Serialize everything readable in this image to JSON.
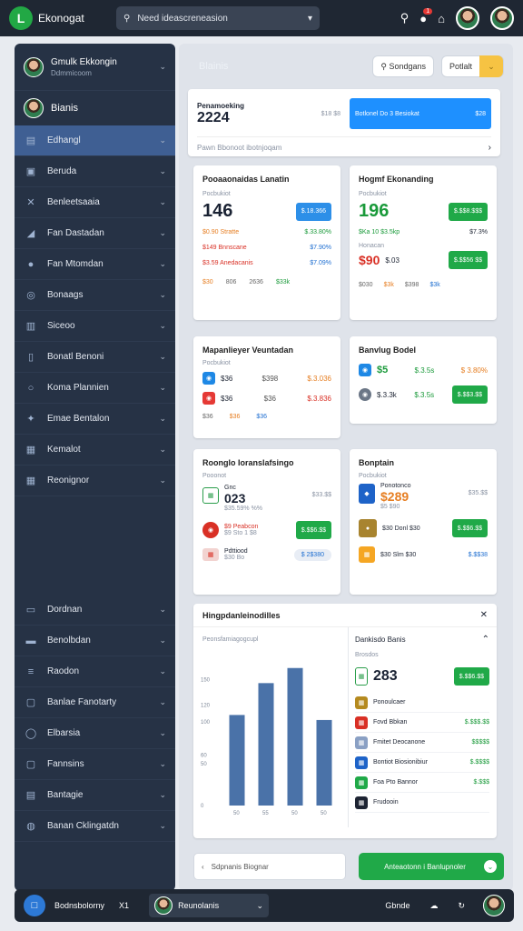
{
  "header": {
    "brand": "Ekonogat",
    "search_placeholder": "Need ideascreneasion",
    "badge_count": "1"
  },
  "sidebar": {
    "user": {
      "name": "Gmulk Ekkongin",
      "sub": "Ddmmicoom"
    },
    "second_user": "Bianis",
    "items": [
      {
        "label": "Edhangl",
        "icon": "▤"
      },
      {
        "label": "Beruda",
        "icon": "▣"
      },
      {
        "label": "Benleetsaaia",
        "icon": "✕"
      },
      {
        "label": "Fan Dastadan",
        "icon": "◢"
      },
      {
        "label": "Fan Mtomdan",
        "icon": "●"
      },
      {
        "label": "Bonaags",
        "icon": "◎"
      },
      {
        "label": "Siceoo",
        "icon": "▥"
      },
      {
        "label": "Bonatl Benoni",
        "icon": "▯"
      },
      {
        "label": "Koma Plannien",
        "icon": "○"
      },
      {
        "label": "Emae Bentalon",
        "icon": "✦"
      },
      {
        "label": "Kemalot",
        "icon": "▦"
      },
      {
        "label": "Reonignor",
        "icon": "▦"
      }
    ],
    "lower_items": [
      {
        "label": "Dordnan",
        "icon": "▭"
      },
      {
        "label": "Benolbdan",
        "icon": "▬"
      },
      {
        "label": "Raodon",
        "icon": "≡"
      },
      {
        "label": "Banlae Fanotarty",
        "icon": "▢"
      },
      {
        "label": "Elbarsia",
        "icon": "◯"
      },
      {
        "label": "Fannsins",
        "icon": "▢"
      },
      {
        "label": "Bantagie",
        "icon": "▤"
      },
      {
        "label": "Banan Cklingatdn",
        "icon": "◍"
      }
    ]
  },
  "main": {
    "title": "Blainis",
    "btn_search": "Sondgans",
    "btn_filter": "Potlalt",
    "summary": {
      "title": "Penamoeking",
      "year": "2224",
      "amount_right": "$18 $8",
      "banner": "Botlonel Do 3 Besiokat",
      "banner_amount": "$28",
      "sub": "Pawn Bbonoot ibotnjoqam"
    },
    "card_a": {
      "title": "Pooaaonaidas Lanatin",
      "sub": "Pocbukiot",
      "value": "146",
      "btn": "$.18.366",
      "line1_l": "$0.90 Stratte",
      "line1_r": "$.33.80%",
      "line2_l": "$149 Bnnscane",
      "line2_r": "$7.90%",
      "line3_l": "$3.59 Anedacanis",
      "line3_r": "$7.09%",
      "foot": [
        "$30",
        "806",
        "2636",
        "$33k"
      ]
    },
    "card_b": {
      "title": "Hogmf Ekonanding",
      "sub": "Pocbukiot",
      "value": "196",
      "btn": "$.$$8.$$$",
      "line1_l": "$Ka 10 $3.5kp",
      "line1_r": "$7.3%",
      "line2_l": "Honacan",
      "val2": "$90",
      "val2b": "$.03",
      "btn2": "$.$$56 $$",
      "foot": [
        "$030",
        "$3k",
        "$398",
        "$3k"
      ]
    },
    "card_c": {
      "title": "Mapanlieyer Veuntadan",
      "sub": "Pocbukiot",
      "a": "$36",
      "a2": "$398",
      "a3": "$.3.036",
      "b": "$36",
      "b2": "$36",
      "b3": "$.3.836",
      "foot": [
        "$36",
        "$36",
        "$36"
      ]
    },
    "card_d": {
      "title": "Banvlug Bodel",
      "a": "$5",
      "a2": "$.3.5s",
      "a3": "$ 3.80%",
      "b": "$.3.3k",
      "b2": "$.3.5s",
      "btn": "$.$$3.$$"
    },
    "card_e": {
      "title": "Roonglo Ioranslafsingo",
      "sub": "Pooonot",
      "value": "023",
      "value_pre": "Gnc",
      "note": "$35.59% %%",
      "r1": "$33.$$",
      "row2": "$9 Peabcon",
      "row2b": "$9 Sto 1 $8",
      "btn": "$.$$6.$$",
      "row3": "Pdttiood",
      "row3b": "$30 Bo",
      "pill": "$ 2$380"
    },
    "card_f": {
      "title": "Bonptain",
      "sub": "Pocbukiot",
      "value": "$289",
      "value_pre": "Ponotonco",
      "note": "$5 $90",
      "r1": "$35.$$",
      "row2": "$30 Donl $30",
      "btn": "$.$$6.$$",
      "row3": "$30 Slm $30",
      "r3": "$.$$38"
    },
    "chart_card": {
      "title": "Hingpdanleinodilles",
      "sub": "Peonsfamiagogcupl",
      "side": {
        "title": "Dankisdo Banis",
        "sub": "Brosdos",
        "value": "283",
        "btn": "$.$$6.$$",
        "rows": [
          {
            "l": "Ponoulcaer",
            "r": ""
          },
          {
            "l": "Fovd Bbkan",
            "r": "$.$$$.$$"
          },
          {
            "l": "Fmitet Deocanone",
            "r": "$$$$$"
          },
          {
            "l": "Bontiot Biosionibiur",
            "r": "$.$$$$"
          },
          {
            "l": "Foa Pto Bannor",
            "r": "$.$$$"
          },
          {
            "l": "Frudooin",
            "r": ""
          }
        ]
      }
    },
    "bottom_input": "Sdpnanis Biognar",
    "bottom_button": "Anteaotonn i Banlupnoler"
  },
  "footer": {
    "label": "Bodnsbolorny",
    "x": "X1",
    "user": "Reunolanis",
    "right_label": "Gbnde"
  },
  "chart_data": {
    "type": "bar",
    "title": "Hingpdanleinodilles",
    "subtitle": "Peonsfamiagogcupl",
    "categories": [
      "50",
      "55",
      "50",
      "50"
    ],
    "values": [
      108,
      146,
      164,
      102
    ],
    "ylim": [
      0,
      180
    ],
    "yticks": [
      150,
      120,
      100,
      60,
      50,
      0
    ],
    "colors": [
      "#4a72a8"
    ],
    "grid": false
  }
}
